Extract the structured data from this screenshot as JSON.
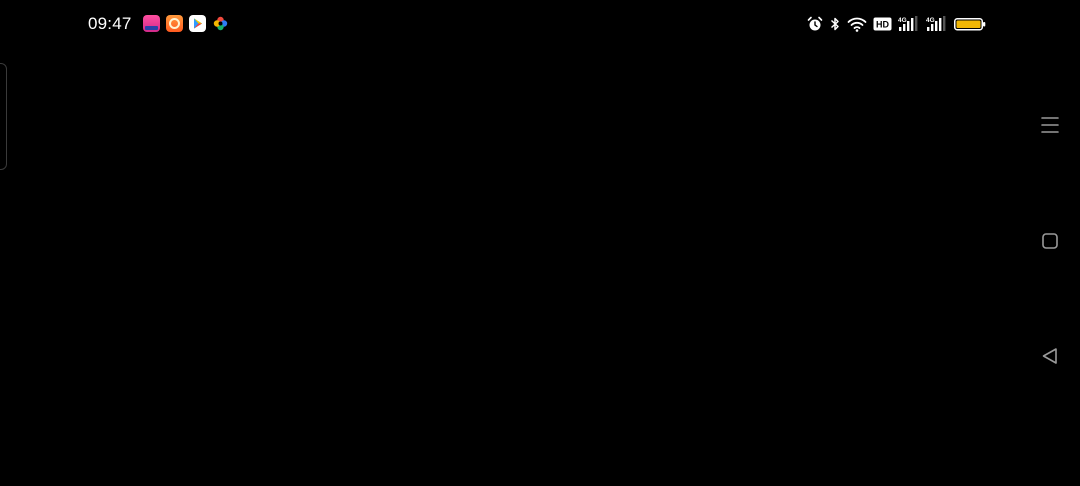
{
  "status_bar": {
    "time": "09:47",
    "notification_icons": [
      "shopping-app-icon",
      "food-app-icon",
      "play-store-icon",
      "photos-app-icon"
    ],
    "system_icons": [
      "alarm-icon",
      "bluetooth-icon",
      "wifi-icon",
      "hd-voice-icon",
      "signal-4g-sim1-icon",
      "signal-4g-sim2-icon",
      "battery-icon"
    ],
    "hd_label": "HD",
    "network_label_1": "4G",
    "network_label_2": "4G"
  },
  "colors": {
    "background": "#000000",
    "battery_fill": "#f2b705",
    "nav_icon": "#9a9a9a"
  },
  "navigation": {
    "buttons": [
      "recents-menu-icon",
      "home-square-icon",
      "back-triangle-icon"
    ]
  }
}
